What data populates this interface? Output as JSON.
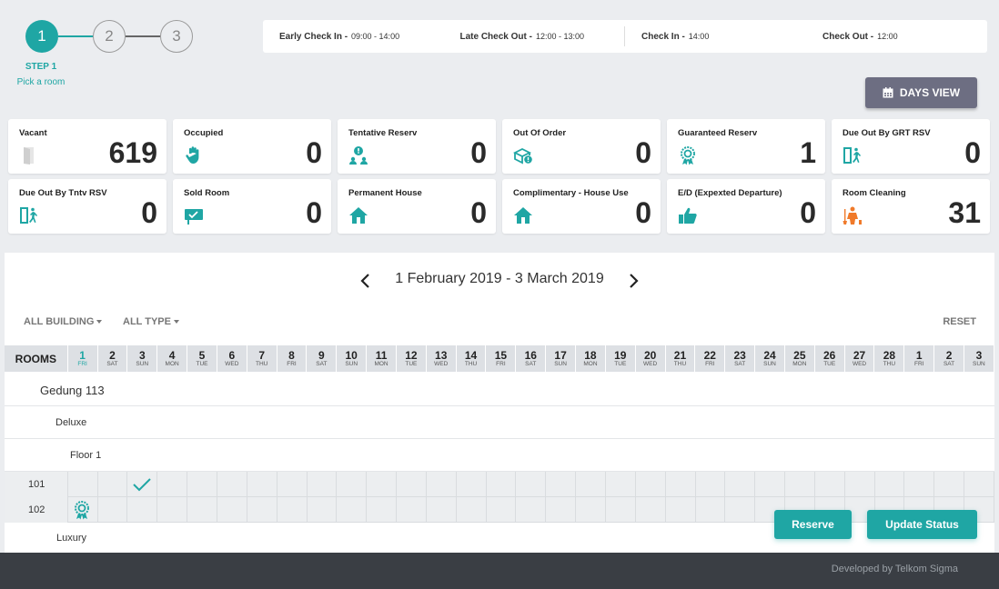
{
  "steps": {
    "items": [
      "1",
      "2",
      "3"
    ],
    "active_label": "STEP 1",
    "active_sub": "Pick a room"
  },
  "times": {
    "early_checkin_label": "Early Check In -",
    "early_checkin_value": "09:00 - 14:00",
    "late_checkout_label": "Late Check Out -",
    "late_checkout_value": "12:00 - 13:00",
    "checkin_label": "Check In -",
    "checkin_value": "14:00",
    "checkout_label": "Check Out -",
    "checkout_value": "12:00"
  },
  "days_view_label": "DAYS VIEW",
  "stats": [
    {
      "label": "Vacant",
      "value": "619",
      "icon": "door-icon"
    },
    {
      "label": "Occupied",
      "value": "0",
      "icon": "hand-stop-icon"
    },
    {
      "label": "Tentative Reserv",
      "value": "0",
      "icon": "user-alert-icon"
    },
    {
      "label": "Out Of Order",
      "value": "0",
      "icon": "box-alert-icon"
    },
    {
      "label": "Guaranteed Reserv",
      "value": "1",
      "icon": "award-badge-icon"
    },
    {
      "label": "Due Out By GRT RSV",
      "value": "0",
      "icon": "exit-door-icon"
    },
    {
      "label": "Due Out By Tntv RSV",
      "value": "0",
      "icon": "exit-door-icon"
    },
    {
      "label": "Sold Room",
      "value": "0",
      "icon": "sold-sign-icon"
    },
    {
      "label": "Permanent House",
      "value": "0",
      "icon": "house-icon"
    },
    {
      "label": "Complimentary - House Use",
      "value": "0",
      "icon": "house-icon"
    },
    {
      "label": "E/D (Expexted Departure)",
      "value": "0",
      "icon": "thumbs-up-icon"
    },
    {
      "label": "Room Cleaning",
      "value": "31",
      "icon": "cleaning-person-icon"
    }
  ],
  "calendar": {
    "range": "1 February 2019 - 3 March 2019",
    "filters": [
      "ALL BUILDING",
      "ALL TYPE"
    ],
    "reset_label": "RESET",
    "rooms_header": "ROOMS",
    "days": [
      {
        "d": "1",
        "w": "FRI"
      },
      {
        "d": "2",
        "w": "SAT"
      },
      {
        "d": "3",
        "w": "SUN"
      },
      {
        "d": "4",
        "w": "MON"
      },
      {
        "d": "5",
        "w": "TUE"
      },
      {
        "d": "6",
        "w": "WED"
      },
      {
        "d": "7",
        "w": "THU"
      },
      {
        "d": "8",
        "w": "FRI"
      },
      {
        "d": "9",
        "w": "SAT"
      },
      {
        "d": "10",
        "w": "SUN"
      },
      {
        "d": "11",
        "w": "MON"
      },
      {
        "d": "12",
        "w": "TUE"
      },
      {
        "d": "13",
        "w": "WED"
      },
      {
        "d": "14",
        "w": "THU"
      },
      {
        "d": "15",
        "w": "FRI"
      },
      {
        "d": "16",
        "w": "SAT"
      },
      {
        "d": "17",
        "w": "SUN"
      },
      {
        "d": "18",
        "w": "MON"
      },
      {
        "d": "19",
        "w": "TUE"
      },
      {
        "d": "20",
        "w": "WED"
      },
      {
        "d": "21",
        "w": "THU"
      },
      {
        "d": "22",
        "w": "FRI"
      },
      {
        "d": "23",
        "w": "SAT"
      },
      {
        "d": "24",
        "w": "SUN"
      },
      {
        "d": "25",
        "w": "MON"
      },
      {
        "d": "26",
        "w": "TUE"
      },
      {
        "d": "27",
        "w": "WED"
      },
      {
        "d": "28",
        "w": "THU"
      },
      {
        "d": "1",
        "w": "FRI"
      },
      {
        "d": "2",
        "w": "SAT"
      },
      {
        "d": "3",
        "w": "SUN"
      }
    ],
    "building": "Gedung 113",
    "room_type_1": "Deluxe",
    "floor": "Floor 1",
    "rooms": [
      "101",
      "102"
    ],
    "room_type_2": "Luxury"
  },
  "actions": {
    "reserve": "Reserve",
    "update_status": "Update Status"
  },
  "footer": "Developed by Telkom Sigma",
  "colors": {
    "accent": "#1fa6a4",
    "orange": "#f07a2a",
    "button_gray": "#6d6e82"
  }
}
